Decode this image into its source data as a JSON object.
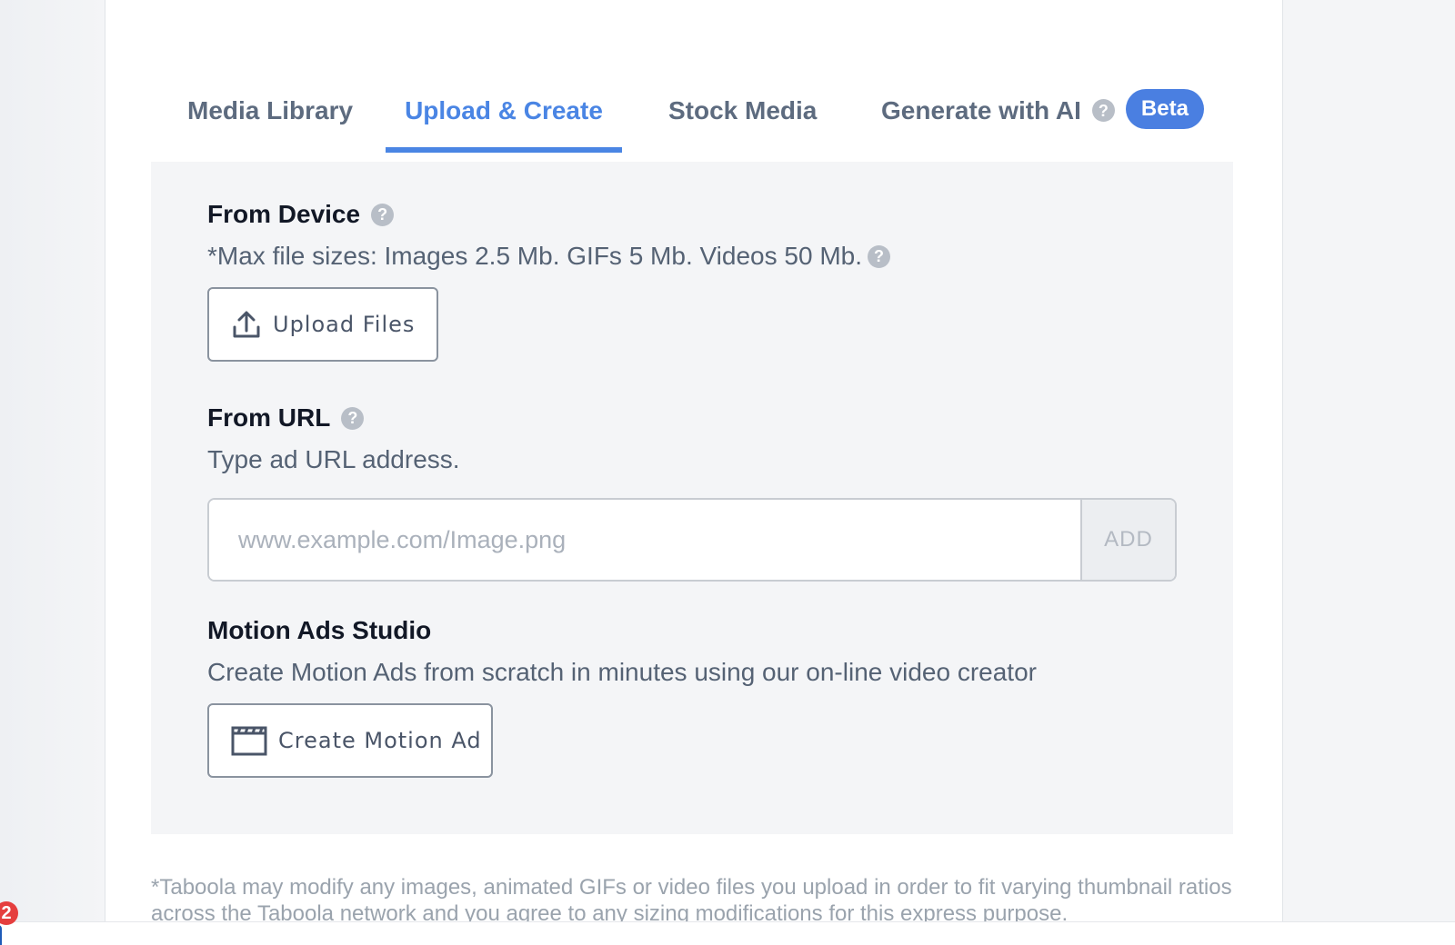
{
  "tabs": [
    {
      "label": "Media Library",
      "active": false
    },
    {
      "label": "Upload & Create",
      "active": true
    },
    {
      "label": "Stock Media",
      "active": false
    },
    {
      "label": "Generate with AI",
      "active": false,
      "badge": "Beta"
    }
  ],
  "help_glyph": "?",
  "from_device": {
    "title": "From Device",
    "description": "*Max file sizes: Images 2.5 Mb. GIFs 5 Mb. Videos 50 Mb.",
    "button_label": "Upload Files",
    "button_icon": "upload-icon"
  },
  "from_url": {
    "title": "From URL",
    "description": "Type ad URL address.",
    "input_value": "",
    "input_placeholder": "www.example.com/Image.png",
    "add_label": "ADD"
  },
  "motion_ads": {
    "title": "Motion Ads Studio",
    "description": "Create Motion Ads from scratch in minutes using our on-line video creator",
    "button_label": "Create Motion Ad",
    "button_icon": "clapperboard-icon"
  },
  "disclaimer": "*Taboola may modify any images, animated GIFs or video files you upload in order to fit varying thumbnail ratios across the Taboola network and you agree to any sizing modifications for this express purpose.",
  "notification_count": "2",
  "colors": {
    "accent": "#4a85e4",
    "beta_badge": "#4a7fe1",
    "notification": "#e53e3e"
  }
}
